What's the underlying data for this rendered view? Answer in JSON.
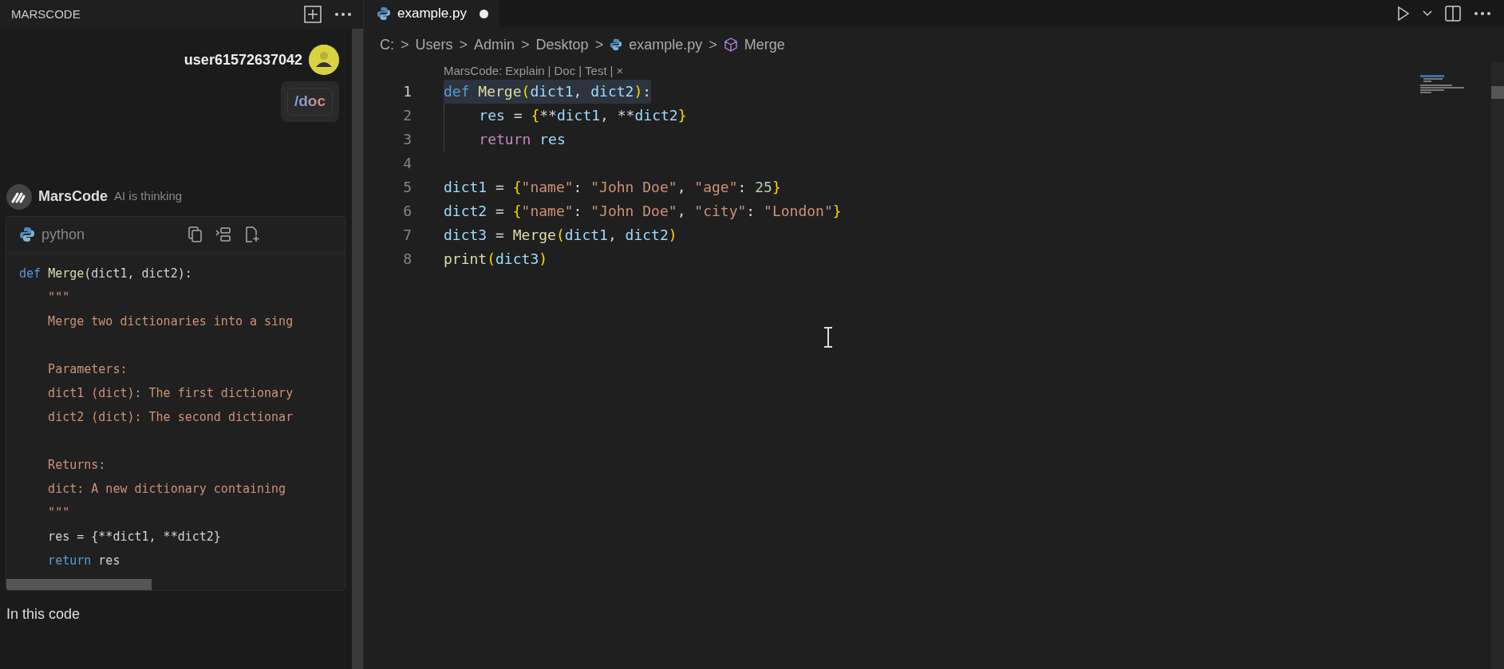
{
  "chat_panel": {
    "title": "MARSCODE",
    "user": {
      "name": "user61572637042",
      "message": "/doc"
    },
    "assistant": {
      "name": "MarsCode",
      "status": "AI is thinking"
    },
    "code_block": {
      "language": "python",
      "lines": [
        {
          "kind": "code",
          "tokens": [
            {
              "text": "def ",
              "kind": "keyword"
            },
            {
              "text": "Merge",
              "kind": "function"
            },
            {
              "text": "(dict1, dict2):",
              "kind": "plain"
            }
          ]
        },
        {
          "kind": "code",
          "tokens": [
            {
              "text": "    \"\"\"",
              "kind": "string"
            }
          ]
        },
        {
          "kind": "code",
          "tokens": [
            {
              "text": "    Merge two dictionaries into a sing",
              "kind": "string"
            }
          ]
        },
        {
          "kind": "blank"
        },
        {
          "kind": "code",
          "tokens": [
            {
              "text": "    Parameters:",
              "kind": "string"
            }
          ]
        },
        {
          "kind": "code",
          "tokens": [
            {
              "text": "    dict1 (dict): The first dictionary",
              "kind": "string"
            }
          ]
        },
        {
          "kind": "code",
          "tokens": [
            {
              "text": "    dict2 (dict): The second dictionar",
              "kind": "string"
            }
          ]
        },
        {
          "kind": "blank"
        },
        {
          "kind": "code",
          "tokens": [
            {
              "text": "    Returns:",
              "kind": "string"
            }
          ]
        },
        {
          "kind": "code",
          "tokens": [
            {
              "text": "    dict: A new dictionary containing",
              "kind": "string"
            }
          ]
        },
        {
          "kind": "code",
          "tokens": [
            {
              "text": "    \"\"\"",
              "kind": "string"
            }
          ]
        },
        {
          "kind": "code",
          "tokens": [
            {
              "text": "    res = {**dict1, **dict2}",
              "kind": "plain"
            }
          ]
        },
        {
          "kind": "code",
          "tokens": [
            {
              "text": "    return",
              "kind": "keyword"
            },
            {
              "text": " res",
              "kind": "plain"
            }
          ]
        }
      ]
    },
    "reply_text": "In this code"
  },
  "editor": {
    "tab": {
      "label": "example.py",
      "modified": true
    },
    "breadcrumbs": [
      {
        "text": "C:",
        "kind": "folder"
      },
      {
        "text": "Users",
        "kind": "folder"
      },
      {
        "text": "Admin",
        "kind": "folder"
      },
      {
        "text": "Desktop",
        "kind": "folder"
      },
      {
        "text": "example.py",
        "kind": "python-file"
      },
      {
        "text": "Merge",
        "kind": "symbol"
      }
    ],
    "breadcrumb_separator": ">",
    "codelens": {
      "prefix": "MarsCode:",
      "actions": [
        "Explain",
        "Doc",
        "Test"
      ],
      "separator": "|",
      "close": "×"
    },
    "lines": [
      {
        "number": "1",
        "selected": true,
        "indented": false,
        "tokens": [
          {
            "text": "def ",
            "kind": "keyword"
          },
          {
            "text": "Merge",
            "kind": "function"
          },
          {
            "text": "(",
            "kind": "bracket"
          },
          {
            "text": "dict1",
            "kind": "variable"
          },
          {
            "text": ", ",
            "kind": "plain"
          },
          {
            "text": "dict2",
            "kind": "variable"
          },
          {
            "text": ")",
            "kind": "bracket"
          },
          {
            "text": ":",
            "kind": "plain"
          }
        ]
      },
      {
        "number": "2",
        "selected": false,
        "indented": true,
        "tokens": [
          {
            "text": "    res",
            "kind": "variable"
          },
          {
            "text": " = ",
            "kind": "plain"
          },
          {
            "text": "{",
            "kind": "bracket"
          },
          {
            "text": "**",
            "kind": "plain"
          },
          {
            "text": "dict1",
            "kind": "variable"
          },
          {
            "text": ", **",
            "kind": "plain"
          },
          {
            "text": "dict2",
            "kind": "variable"
          },
          {
            "text": "}",
            "kind": "bracket"
          }
        ]
      },
      {
        "number": "3",
        "selected": false,
        "indented": true,
        "tokens": [
          {
            "text": "    return ",
            "kind": "control"
          },
          {
            "text": "res",
            "kind": "variable"
          }
        ]
      },
      {
        "number": "4",
        "selected": false,
        "indented": false
      },
      {
        "number": "5",
        "selected": false,
        "indented": false,
        "tokens": [
          {
            "text": "dict1",
            "kind": "variable"
          },
          {
            "text": " = ",
            "kind": "plain"
          },
          {
            "text": "{",
            "kind": "bracket"
          },
          {
            "text": "\"name\"",
            "kind": "string"
          },
          {
            "text": ": ",
            "kind": "plain"
          },
          {
            "text": "\"John Doe\"",
            "kind": "string"
          },
          {
            "text": ", ",
            "kind": "plain"
          },
          {
            "text": "\"age\"",
            "kind": "string"
          },
          {
            "text": ": ",
            "kind": "plain"
          },
          {
            "text": "25",
            "kind": "number"
          },
          {
            "text": "}",
            "kind": "bracket"
          }
        ]
      },
      {
        "number": "6",
        "selected": false,
        "indented": false,
        "tokens": [
          {
            "text": "dict2",
            "kind": "variable"
          },
          {
            "text": " = ",
            "kind": "plain"
          },
          {
            "text": "{",
            "kind": "bracket"
          },
          {
            "text": "\"name\"",
            "kind": "string"
          },
          {
            "text": ": ",
            "kind": "plain"
          },
          {
            "text": "\"John Doe\"",
            "kind": "string"
          },
          {
            "text": ", ",
            "kind": "plain"
          },
          {
            "text": "\"city\"",
            "kind": "string"
          },
          {
            "text": ": ",
            "kind": "plain"
          },
          {
            "text": "\"London\"",
            "kind": "string"
          },
          {
            "text": "}",
            "kind": "bracket"
          }
        ]
      },
      {
        "number": "7",
        "selected": false,
        "indented": false,
        "tokens": [
          {
            "text": "dict3",
            "kind": "variable"
          },
          {
            "text": " = ",
            "kind": "plain"
          },
          {
            "text": "Merge",
            "kind": "function"
          },
          {
            "text": "(",
            "kind": "bracket"
          },
          {
            "text": "dict1",
            "kind": "variable"
          },
          {
            "text": ", ",
            "kind": "plain"
          },
          {
            "text": "dict2",
            "kind": "variable"
          },
          {
            "text": ")",
            "kind": "bracket"
          }
        ]
      },
      {
        "number": "8",
        "selected": false,
        "indented": false,
        "tokens": [
          {
            "text": "print",
            "kind": "function"
          },
          {
            "text": "(",
            "kind": "bracket"
          },
          {
            "text": "dict3",
            "kind": "variable"
          },
          {
            "text": ")",
            "kind": "bracket"
          }
        ]
      }
    ]
  }
}
